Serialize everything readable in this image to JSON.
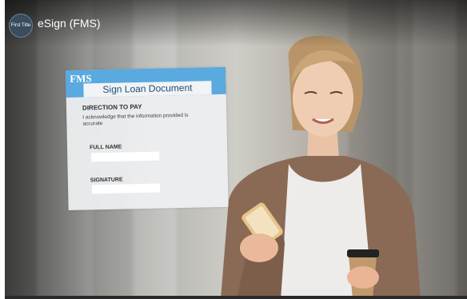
{
  "video": {
    "title": "eSign (FMS)",
    "channel_logo_text": "First Title"
  },
  "form": {
    "logo": "FMS",
    "title": "Sign Loan Document",
    "section": "DIRECTION TO PAY",
    "acknowledgement": "I acknowledge that the information provided is accurate",
    "full_name_label": "FULL NAME",
    "full_name_value": "",
    "signature_label": "SIGNATURE",
    "signature_value": ""
  },
  "colors": {
    "form_header": "#5aa9df",
    "form_title_text": "#1f4e79"
  }
}
